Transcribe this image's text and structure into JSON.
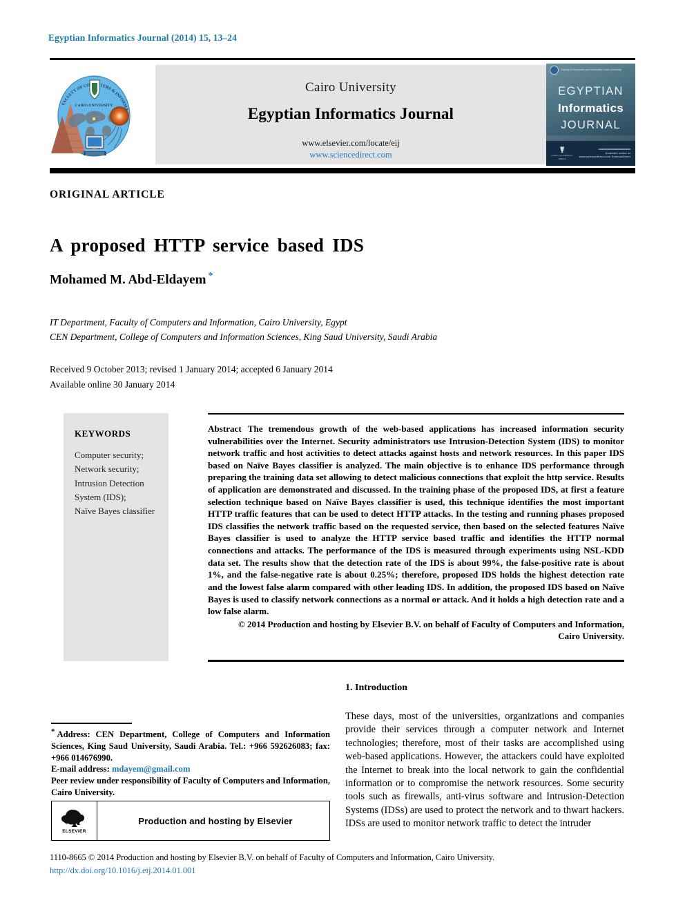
{
  "running_head": "Egyptian Informatics Journal (2014) 15, 13–24",
  "masthead": {
    "university": "Cairo University",
    "journal_title": "Egyptian Informatics Journal",
    "url_publisher": "www.elsevier.com/locate/eij",
    "url_sciencedirect": "www.sciencedirect.com",
    "logo_alt": "Faculty of Computers & Information, Cairo University emblem",
    "cover": {
      "line1": "EGYPTIAN",
      "line2": "Informatics",
      "line3": "JOURNAL",
      "top_text": "Faculty of Computers and Information\nCairo University",
      "footer_left": "CAIRO UNIVERSITY PRESS",
      "footer_right": "Available online at www.sciencedirect.com\nScienceDirect"
    }
  },
  "article": {
    "type_label": "ORIGINAL ARTICLE",
    "title": "A proposed HTTP service based IDS",
    "author": "Mohamed M. Abd-Eldayem",
    "author_footnote_marker": "*",
    "affiliations": [
      "IT Department, Faculty of Computers and Information, Cairo University, Egypt",
      "CEN Department, College of Computers and Information Sciences, King Saud University, Saudi Arabia"
    ],
    "history": [
      "Received 9 October 2013; revised 1 January 2014; accepted 6 January 2014",
      "Available online 30 January 2014"
    ]
  },
  "keywords": {
    "heading": "KEYWORDS",
    "items": [
      "Computer security;",
      "Network security;",
      "Intrusion Detection System (IDS);",
      "Naïve Bayes classifier"
    ]
  },
  "abstract": {
    "label": "Abstract",
    "text": "The tremendous growth of the web-based applications has increased information security vulnerabilities over the Internet. Security administrators use Intrusion-Detection System (IDS) to monitor network traffic and host activities to detect attacks against hosts and network resources. In this paper IDS based on Naïve Bayes classifier is analyzed. The main objective is to enhance IDS performance through preparing the training data set allowing to detect malicious connections that exploit the http service. Results of application are demonstrated and discussed. In the training phase of the proposed IDS, at first a feature selection technique based on Naïve Bayes classifier is used, this technique identifies the most important HTTP traffic features that can be used to detect HTTP attacks. In the testing and running phases proposed IDS classifies the network traffic based on the requested service, then based on the selected features Naïve Bayes classifier is used to analyze the HTTP service based traffic and identifies the HTTP normal connections and attacks. The performance of the IDS is measured through experiments using NSL-KDD data set. The results show that the detection rate of the IDS is about 99%, the false-positive rate is about 1%, and the false-negative rate is about 0.25%; therefore, proposed IDS holds the highest detection rate and the lowest false alarm compared with other leading IDS. In addition, the proposed IDS based on Naïve Bayes is used to classify network connections as a normal or attack. And it holds a high detection rate and a low false alarm.",
    "copyright_line1": "© 2014 Production and hosting by Elsevier B.V. on behalf of Faculty of Computers and Information,",
    "copyright_line2": "Cairo University."
  },
  "introduction": {
    "heading": "1. Introduction",
    "paragraph": "These days, most of the universities, organizations and companies provide their services through a computer network and Internet technologies; therefore, most of their tasks are accomplished using web-based applications. However, the attackers could have exploited the Internet to break into the local network to gain the confidential information or to compromise the network resources. Some security tools such as firewalls, anti-virus software and Intrusion-Detection Systems (IDSs) are used to protect the network and to thwart hackers. IDSs are used to monitor network traffic to detect the intruder"
  },
  "footnote": {
    "star": "*",
    "address": "Address: CEN Department, College of Computers and Information Sciences, King Saud University, Saudi Arabia. Tel.: +966 592626083; fax: +966 014676990.",
    "email_label": "E-mail address:",
    "email": "mdayem@gmail.com",
    "peer_review": "Peer review under responsibility of Faculty of Computers and Information, Cairo University."
  },
  "elsevier_box": {
    "logo_word": "ELSEVIER",
    "text": "Production and hosting by Elsevier"
  },
  "bottom": {
    "copyright": "1110-8665 © 2014 Production and hosting by Elsevier B.V. on behalf of Faculty of Computers and Information, Cairo University.",
    "doi": "http://dx.doi.org/10.1016/j.eij.2014.01.001"
  },
  "colors": {
    "link_blue": "#2277bb",
    "running_head_blue": "#1a7ba8",
    "panel_gray": "#e4e4e4"
  }
}
